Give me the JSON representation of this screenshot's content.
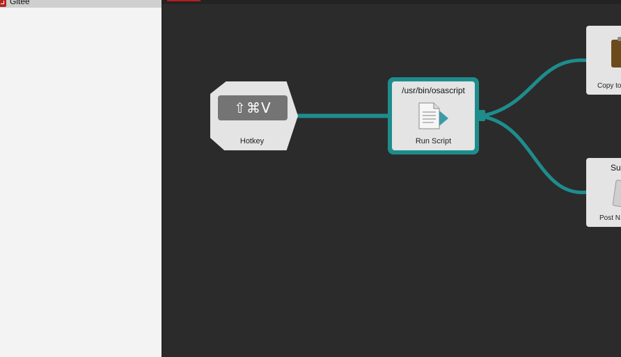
{
  "sidebar": {
    "selected_item": {
      "label": "Gitee",
      "icon": "gitee-icon"
    }
  },
  "colors": {
    "canvas_background": "#2b2b2b",
    "connection": "#1f8c8c",
    "node_background": "#e4e4e4",
    "accent_red": "#b21f1f"
  },
  "nodes": {
    "hotkey": {
      "key_combo": "⇧⌘V",
      "label": "Hotkey"
    },
    "run_script": {
      "title": "/usr/bin/osascript",
      "label": "Run Script",
      "icon": "script-document-icon"
    },
    "copy_to_clipboard": {
      "label": "Copy to",
      "icon": "clipboard-icon"
    },
    "post_notification": {
      "title": "Su",
      "label": "Post N",
      "icon": "notification-icon"
    }
  }
}
